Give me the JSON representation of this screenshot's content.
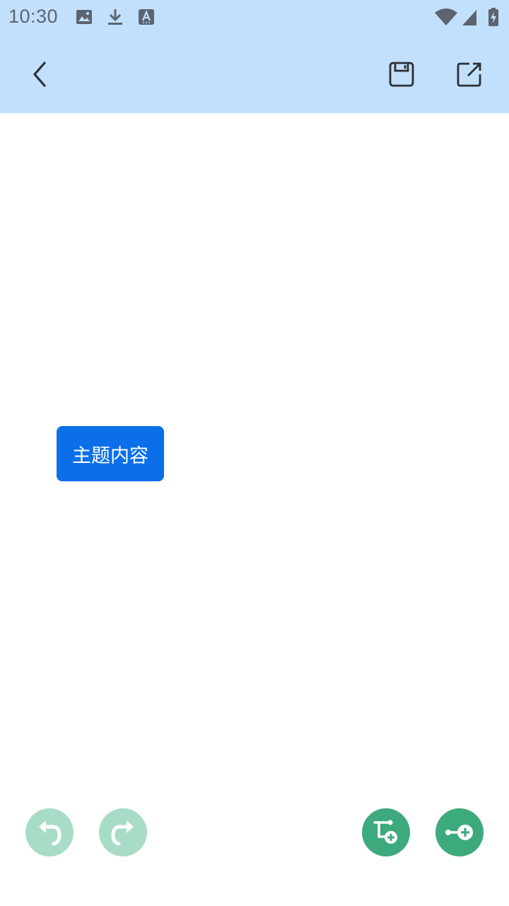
{
  "status_bar": {
    "time": "10:30",
    "left_icons": [
      "image-icon",
      "download-icon",
      "font-icon"
    ],
    "right_icons": [
      "wifi-icon",
      "signal-icon",
      "battery-charging-icon"
    ]
  },
  "toolbar": {
    "back_icon": "chevron-left-icon",
    "save_icon": "save-icon",
    "export_icon": "export-icon"
  },
  "canvas": {
    "topic_label": "主题内容"
  },
  "bottom_actions": {
    "undo_icon": "undo-icon",
    "redo_icon": "redo-icon",
    "add_subtopic_icon": "add-subtopic-icon",
    "add_sibling_icon": "add-sibling-icon"
  },
  "colors": {
    "topbar_bg": "#c2e0fc",
    "topic_bg": "#0a6fe9",
    "fab_active": "#3daa7e",
    "fab_disabled": "#a9dcc6"
  }
}
